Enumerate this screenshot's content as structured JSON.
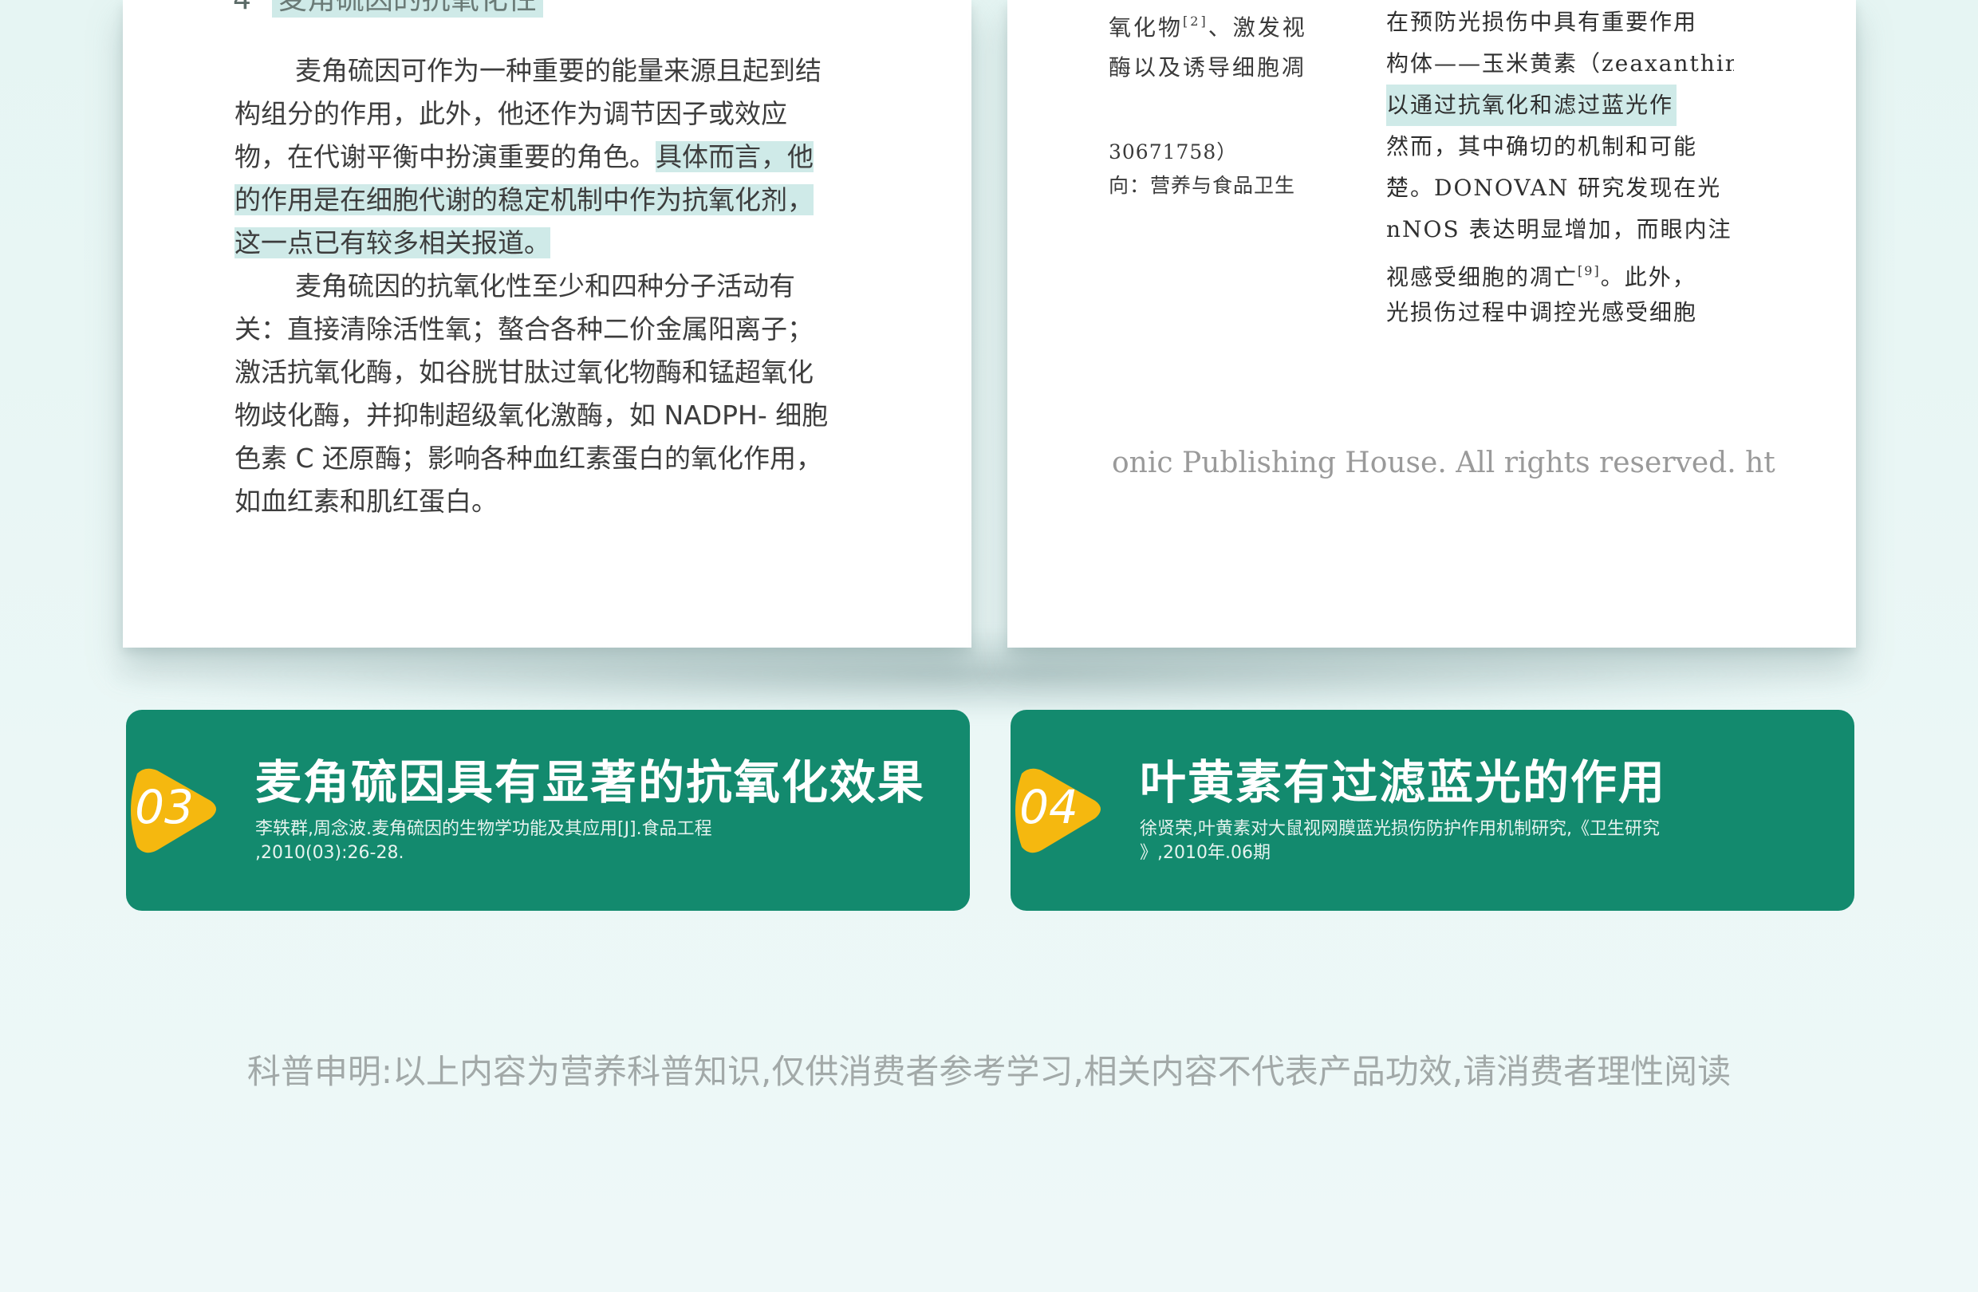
{
  "left_page": {
    "heading_number": "4",
    "heading": "麦角硫因的抗氧化性",
    "para1": [
      "麦角硫因可作为一种重要的能量来源且起到结",
      "构组分的作用，此外，他还作为调节因子或效应",
      "物，在代谢平衡中扮演重要的角色。",
      "具体而言，他",
      "的作用是在细胞代谢的稳定机制中作为抗氧化剂，",
      "这一点已有较多相关报道。"
    ],
    "para2": [
      "麦角硫因的抗氧化性至少和四种分子活动有",
      "关：直接清除活性氧；螯合各种二价金属阳离子；",
      "激活抗氧化酶，如谷胱甘肽过氧化物酶和锰超氧化",
      "物歧化酶，并抑制超级氧化激酶，如 NADPH- 细胞",
      "色素 C 还原酶；影响各种血红素蛋白的氧化作用，",
      "如血红素和肌红蛋白。"
    ]
  },
  "right_page": {
    "col1_line1": "氧化物",
    "col1_sup1": "[2]",
    "col1_line1_tail": "、激发视",
    "col1_line2": "酶以及诱导细胞凋",
    "col1_line3": "30671758）",
    "col1_line4": "向：营养与食品卫生",
    "col2_lines": [
      "在预防光损伤中具有重要作用",
      "构体——玉米黄素（zeaxanthin",
      "以通过抗氧化和滤过蓝光作",
      "然而，其中确切的机制和可能",
      "楚。DONOVAN 研究发现在光",
      "nNOS 表达明显增加，而眼内注"
    ],
    "col2_line7": "视感受细胞的凋亡",
    "col2_sup": "[9]",
    "col2_line7_tail": "。此外，",
    "col2_line8": "光损伤过程中调控光感受细胞",
    "copyright": "onic Publishing House. All rights reserved.     ht"
  },
  "cards": [
    {
      "number": "03",
      "title": "麦角硫因具有显著的抗氧化效果",
      "ref_line1": "李轶群,周念波.麦角硫因的生物学功能及其应用[J].食品工程",
      "ref_line2": ",2010(03):26-28."
    },
    {
      "number": "04",
      "title": "叶黄素有过滤蓝光的作用",
      "ref_line1": "徐贤荣,叶黄素对大鼠视网膜蓝光损伤防护作用机制研究,《卫生研究",
      "ref_line2": "》,2010年.06期"
    }
  ],
  "disclaimer": "科普申明:以上内容为营养科普知识,仅供消费者参考学习,相关内容不代表产品功效,请消费者理性阅读",
  "colors": {
    "background": "#e6f5f3",
    "card_green": "#138a6e",
    "badge_yellow": "#f5b80f",
    "highlight": "#cfeae8"
  }
}
